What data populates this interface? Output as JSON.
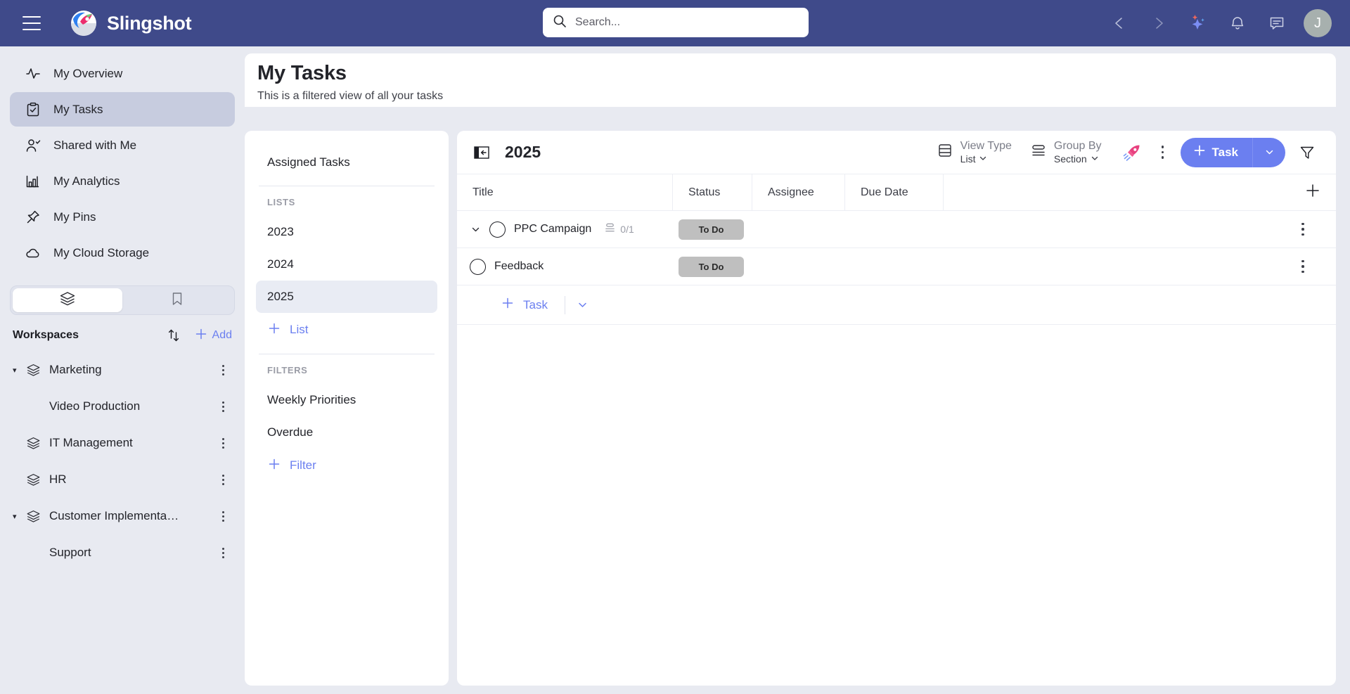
{
  "app": {
    "brand_name": "Slingshot",
    "accent": "#6b7ff0",
    "topbar_bg": "#3f4a8a",
    "badge_bg": "#bfbfbf"
  },
  "topbar": {
    "menu_icon": "hamburger-icon",
    "logo_icon": "slingshot-rocket-logo",
    "back_icon": "chevron-left-icon",
    "forward_icon": "chevron-right-icon",
    "ai_icon": "sparkles-icon",
    "notifications_icon": "bell-icon",
    "messages_icon": "chat-icon",
    "avatar_initial": "J"
  },
  "search": {
    "placeholder": "Search...",
    "value": "",
    "icon": "search-icon"
  },
  "sidebar": {
    "nav": [
      {
        "label": "My Overview",
        "icon": "activity-pulse-icon",
        "active": false
      },
      {
        "label": "My Tasks",
        "icon": "clipboard-check-icon",
        "active": true
      },
      {
        "label": "Shared with Me",
        "icon": "user-check-icon",
        "active": false
      },
      {
        "label": "My Analytics",
        "icon": "bar-chart-icon",
        "active": false
      },
      {
        "label": "My Pins",
        "icon": "pin-icon",
        "active": false
      },
      {
        "label": "My Cloud Storage",
        "icon": "cloud-icon",
        "active": false
      }
    ],
    "segments": [
      {
        "icon": "layers-icon",
        "active": true
      },
      {
        "icon": "bookmark-icon",
        "active": false
      }
    ],
    "workspaces_title": "Workspaces",
    "sort_icon": "sort-arrows-icon",
    "add_label": "Add",
    "add_icon": "plus-icon",
    "workspaces": [
      {
        "label": "Marketing",
        "child": false,
        "expanded": true
      },
      {
        "label": "Video Production",
        "child": true,
        "expanded": false
      },
      {
        "label": "IT Management",
        "child": false,
        "expanded": null
      },
      {
        "label": "HR",
        "child": false,
        "expanded": null
      },
      {
        "label": "Customer Implementa…",
        "child": false,
        "expanded": true
      },
      {
        "label": "Support",
        "child": true,
        "expanded": false
      }
    ]
  },
  "page": {
    "title": "My Tasks",
    "subtitle": "This is a filtered view of all your tasks"
  },
  "mid_panel": {
    "assigned_tasks": "Assigned Tasks",
    "lists_header": "LISTS",
    "lists": [
      {
        "label": "2023",
        "selected": false
      },
      {
        "label": "2024",
        "selected": false
      },
      {
        "label": "2025",
        "selected": true
      }
    ],
    "add_list_label": "List",
    "filters_header": "FILTERS",
    "filters": [
      {
        "label": "Weekly Priorities",
        "selected": false
      },
      {
        "label": "Overdue",
        "selected": false
      }
    ],
    "add_filter_label": "Filter"
  },
  "main": {
    "collapse_icon": "collapse-panel-icon",
    "board_name": "2025",
    "view_type": {
      "label": "View Type",
      "value": "List",
      "icon": "list-view-icon"
    },
    "group_by": {
      "label": "Group By",
      "value": "Section",
      "icon": "group-by-icon"
    },
    "rocket_icon": "rocket-icon",
    "more_icon": "kebab-menu-icon",
    "add_task_label": "Task",
    "add_task_icon": "plus-icon",
    "dropdown_icon": "chevron-down-icon",
    "filter_icon": "funnel-filter-icon",
    "columns": [
      "Title",
      "Status",
      "Assignee",
      "Due Date"
    ],
    "add_column_icon": "plus-icon",
    "rows": [
      {
        "title": "PPC Campaign",
        "status": "To Do",
        "assignee": "",
        "due_date": "",
        "subtask_count": "0/1",
        "subtask_icon": "subtask-icon",
        "expanded": true,
        "is_subtask": false
      },
      {
        "title": "Feedback",
        "status": "To Do",
        "assignee": "",
        "due_date": "",
        "subtask_count": "",
        "subtask_icon": "",
        "expanded": false,
        "is_subtask": true
      }
    ],
    "add_row_label": "Task"
  }
}
